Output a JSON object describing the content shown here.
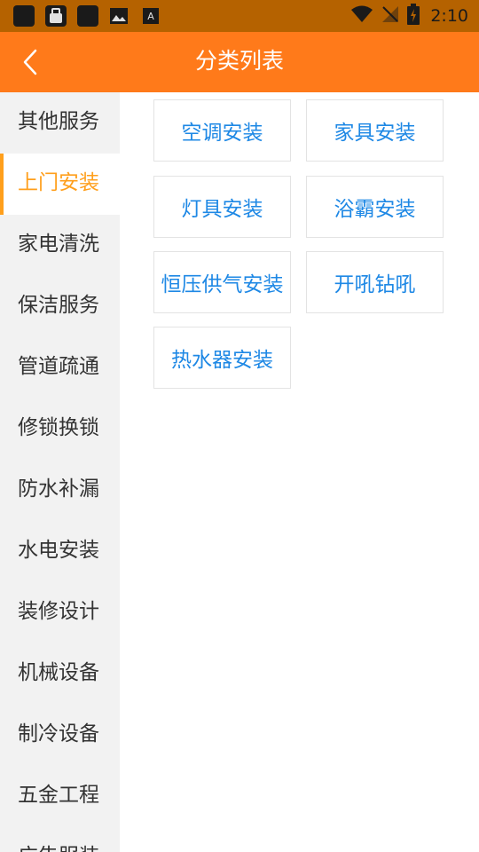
{
  "status_bar": {
    "time": "2:10",
    "icons": [
      "app-icon",
      "notification-bag-icon",
      "app-icon-2",
      "image-icon",
      "font-a-icon",
      "wifi-icon",
      "no-signal-icon",
      "battery-charging-icon"
    ]
  },
  "header": {
    "title": "分类列表",
    "back_icon": "chevron-left-icon"
  },
  "sidebar": {
    "items": [
      {
        "label": "其他服务"
      },
      {
        "label": "上门安装"
      },
      {
        "label": "家电清洗"
      },
      {
        "label": "保洁服务"
      },
      {
        "label": "管道疏通"
      },
      {
        "label": "修锁换锁"
      },
      {
        "label": "防水补漏"
      },
      {
        "label": "水电安装"
      },
      {
        "label": "装修设计"
      },
      {
        "label": "机械设备"
      },
      {
        "label": "制冷设备"
      },
      {
        "label": "五金工程"
      },
      {
        "label": "广告服装"
      }
    ],
    "active_index": 1
  },
  "categories": [
    {
      "label": "空调安装"
    },
    {
      "label": "家具安装"
    },
    {
      "label": "灯具安装"
    },
    {
      "label": "浴霸安装"
    },
    {
      "label": "恒压供气安装"
    },
    {
      "label": "开吼钻吼"
    },
    {
      "label": "热水器安装"
    }
  ],
  "colors": {
    "accent": "#ff7a1a",
    "active": "#ff9f1c",
    "link": "#1e88e5",
    "status_bar": "#b56200"
  }
}
